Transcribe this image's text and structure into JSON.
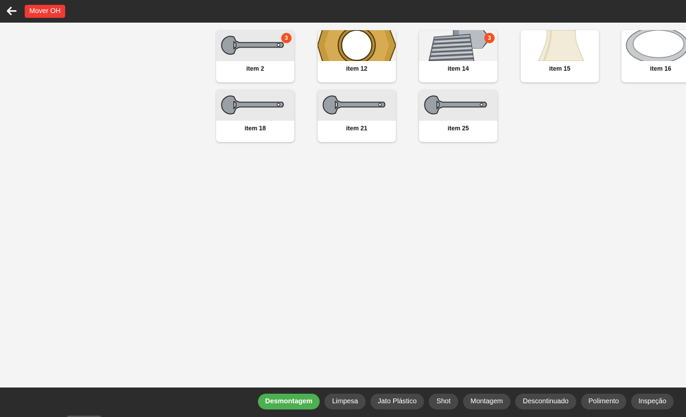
{
  "header": {
    "back_icon": "arrow-left-icon",
    "mover_label": "Mover OH",
    "accent_color": "#ef3b33"
  },
  "items": [
    {
      "label": "item 2",
      "image": "wrench-icon",
      "badge": "3"
    },
    {
      "label": "item 12",
      "image": "hex-nut-image",
      "badge": ""
    },
    {
      "label": "item 14",
      "image": "threaded-bolt-image",
      "badge": "3"
    },
    {
      "label": "item 15",
      "image": "cream-part-image",
      "badge": ""
    },
    {
      "label": "item 16",
      "image": "ring-image",
      "badge": ""
    },
    {
      "label": "item 18",
      "image": "wrench-icon",
      "badge": ""
    },
    {
      "label": "item 21",
      "image": "wrench-icon",
      "badge": ""
    },
    {
      "label": "item 25",
      "image": "wrench-icon",
      "badge": ""
    }
  ],
  "footer": {
    "stages": [
      "Desmontagem",
      "Limpesa",
      "Jato Plástico",
      "Shot",
      "Montagem",
      "Descontinuado",
      "Polimento",
      "Inspeção"
    ],
    "active_stage": "Desmontagem",
    "active_color": "#4caf50"
  }
}
